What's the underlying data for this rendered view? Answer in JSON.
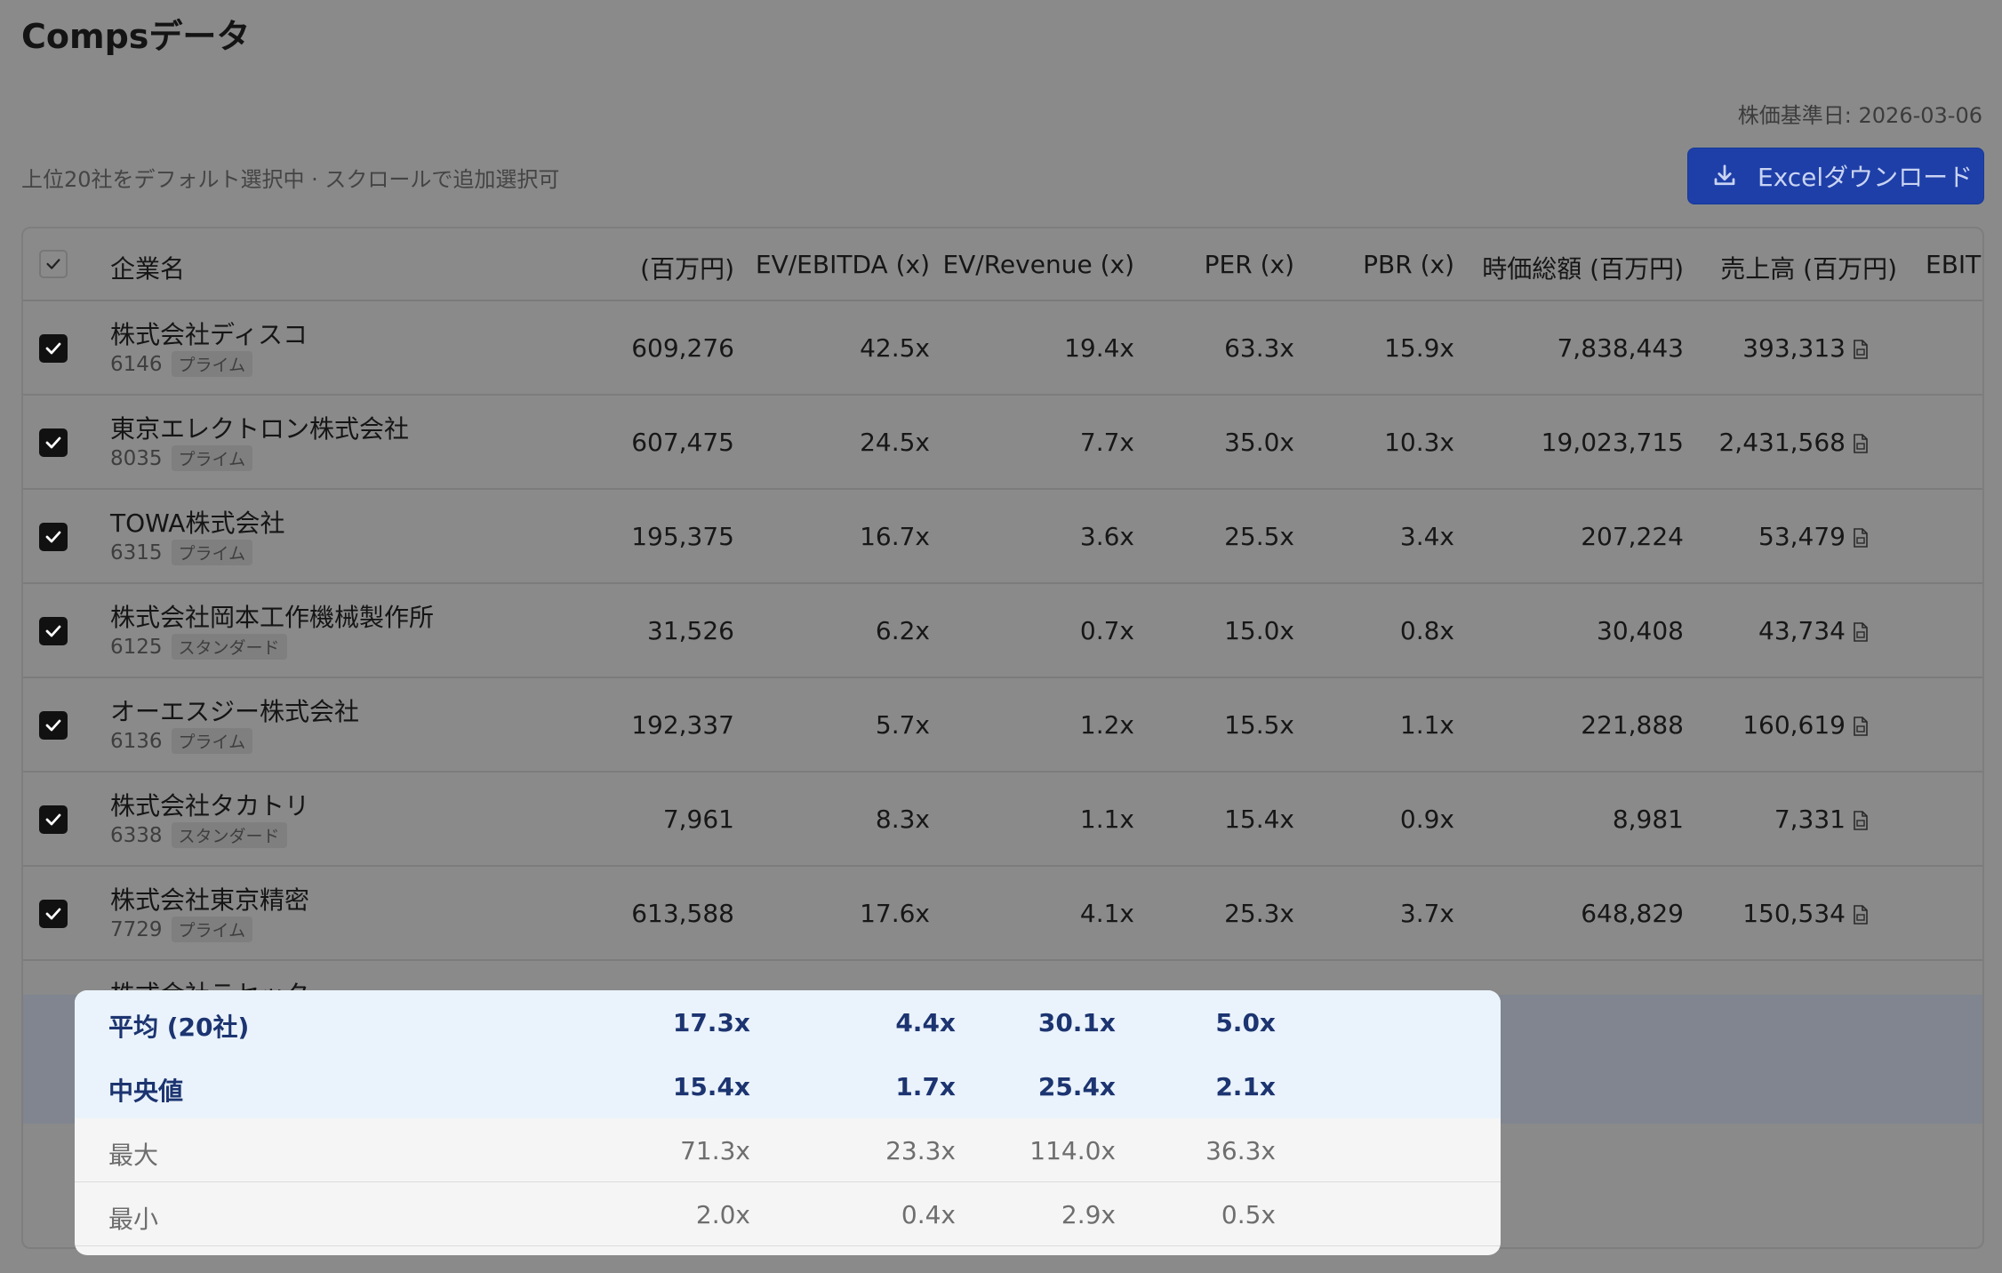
{
  "title": "Compsデータ",
  "price_date": "株価基準日: 2026-03-06",
  "subtitle": "上位20社をデフォルト選択中 · スクロールで追加選択可",
  "excel_button": "Excelダウンロード",
  "columns": {
    "company": "企業名",
    "ev": "(百万円)",
    "ev_ebitda": "EV/EBITDA (x)",
    "ev_revenue": "EV/Revenue (x)",
    "per": "PER (x)",
    "pbr": "PBR (x)",
    "market_cap": "時価総額 (百万円)",
    "revenue": "売上高 (百万円)",
    "ebitda": "EBITI"
  },
  "rows": [
    {
      "name": "株式会社ディスコ",
      "code": "6146",
      "market": "プライム",
      "ev": "609,276",
      "ev_ebitda": "42.5x",
      "ev_revenue": "19.4x",
      "per": "63.3x",
      "pbr": "15.9x",
      "market_cap": "7,838,443",
      "revenue": "393,313"
    },
    {
      "name": "東京エレクトロン株式会社",
      "code": "8035",
      "market": "プライム",
      "ev": "607,475",
      "ev_ebitda": "24.5x",
      "ev_revenue": "7.7x",
      "per": "35.0x",
      "pbr": "10.3x",
      "market_cap": "19,023,715",
      "revenue": "2,431,568"
    },
    {
      "name": "TOWA株式会社",
      "code": "6315",
      "market": "プライム",
      "ev": "195,375",
      "ev_ebitda": "16.7x",
      "ev_revenue": "3.6x",
      "per": "25.5x",
      "pbr": "3.4x",
      "market_cap": "207,224",
      "revenue": "53,479"
    },
    {
      "name": "株式会社岡本工作機械製作所",
      "code": "6125",
      "market": "スタンダード",
      "ev": "31,526",
      "ev_ebitda": "6.2x",
      "ev_revenue": "0.7x",
      "per": "15.0x",
      "pbr": "0.8x",
      "market_cap": "30,408",
      "revenue": "43,734"
    },
    {
      "name": "オーエスジー株式会社",
      "code": "6136",
      "market": "プライム",
      "ev": "192,337",
      "ev_ebitda": "5.7x",
      "ev_revenue": "1.2x",
      "per": "15.5x",
      "pbr": "1.1x",
      "market_cap": "221,888",
      "revenue": "160,619"
    },
    {
      "name": "株式会社タカトリ",
      "code": "6338",
      "market": "スタンダード",
      "ev": "7,961",
      "ev_ebitda": "8.3x",
      "ev_revenue": "1.1x",
      "per": "15.4x",
      "pbr": "0.9x",
      "market_cap": "8,981",
      "revenue": "7,331"
    },
    {
      "name": "株式会社東京精密",
      "code": "7729",
      "market": "プライム",
      "ev": "613,588",
      "ev_ebitda": "17.6x",
      "ev_revenue": "4.1x",
      "per": "25.3x",
      "pbr": "3.7x",
      "market_cap": "648,829",
      "revenue": "150,534"
    }
  ],
  "peek_row": {
    "name": "株式会社テセック"
  },
  "summary": [
    {
      "label": "平均 (20社)",
      "ev_ebitda": "17.3x",
      "ev_revenue": "4.4x",
      "per": "30.1x",
      "pbr": "5.0x"
    },
    {
      "label": "中央値",
      "ev_ebitda": "15.4x",
      "ev_revenue": "1.7x",
      "per": "25.4x",
      "pbr": "2.1x"
    },
    {
      "label": "最大",
      "ev_ebitda": "71.3x",
      "ev_revenue": "23.3x",
      "per": "114.0x",
      "pbr": "36.3x"
    },
    {
      "label": "最小",
      "ev_ebitda": "2.0x",
      "ev_revenue": "0.4x",
      "per": "2.9x",
      "pbr": "0.5x"
    }
  ],
  "colors": {
    "accent": "#1e3fa8",
    "summary_blue_text": "#1c3470",
    "summary_blue_bg": "#eaf3fc"
  },
  "icons": {
    "download": "download-icon",
    "document": "document-icon",
    "check": "check-icon"
  }
}
